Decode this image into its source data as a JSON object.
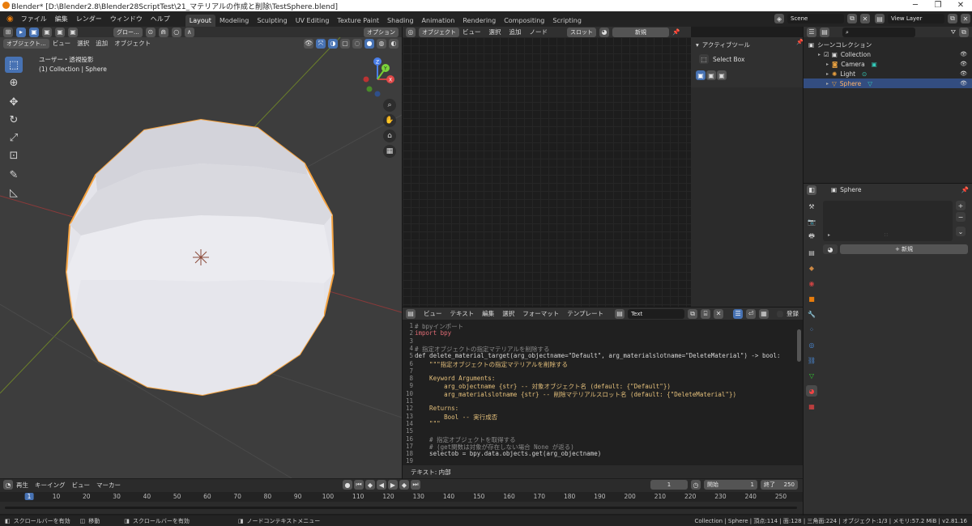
{
  "window": {
    "title": "Blender* [D:\\Blender2.8\\Blender28ScriptTest\\21_マテリアルの作成と削除\\TestSphere.blend]",
    "minimize": "─",
    "maximize": "❐",
    "close": "✕"
  },
  "topbar": {
    "menus": [
      "ファイル",
      "編集",
      "レンダー",
      "ウィンドウ",
      "ヘルプ"
    ],
    "workspaces": [
      "Layout",
      "Modeling",
      "Sculpting",
      "UV Editing",
      "Texture Paint",
      "Shading",
      "Animation",
      "Rendering",
      "Compositing",
      "Scripting"
    ],
    "active_workspace": "Layout",
    "scene": "Scene",
    "view_layer": "View Layer"
  },
  "viewport": {
    "mode": "オブジェクト...",
    "menus": [
      "ビュー",
      "選択",
      "追加",
      "オブジェクト"
    ],
    "transform": "グロー...",
    "options": "オプション",
    "overlay_title": "ユーザー・透視投影",
    "overlay_sub": "(1) Collection | Sphere",
    "gizmo": {
      "x": "X",
      "y": "Y",
      "z": "Z"
    }
  },
  "node_editor": {
    "mode": "オブジェクト",
    "menus": [
      "ビュー",
      "選択",
      "追加",
      "ノード"
    ],
    "slot": "スロット",
    "new": "新規",
    "active_tool": "アクティブツール",
    "select_box": "Select Box"
  },
  "text_editor": {
    "menus": [
      "ビュー",
      "テキスト",
      "編集",
      "選択",
      "フォーマット",
      "テンプレート"
    ],
    "filename": "Text",
    "register": "登録",
    "footer": "テキスト: 内部",
    "lines": [
      {
        "n": "1",
        "t": "# bpyインポート",
        "c": "cm"
      },
      {
        "n": "2",
        "t": "import bpy",
        "c": "kw"
      },
      {
        "n": "3",
        "t": "",
        "c": "fn"
      },
      {
        "n": "4",
        "t": "# 指定オブジェクトの指定マテリアルを削除する",
        "c": "cm"
      },
      {
        "n": "5",
        "t": "def delete_material_target(arg_objectname=\"Default\", arg_materialslotname=\"DeleteMaterial\") -> bool:",
        "c": "fn"
      },
      {
        "n": "6",
        "t": "    \"\"\"指定オブジェクトの指定マテリアルを削除する",
        "c": "st"
      },
      {
        "n": "7",
        "t": "",
        "c": "fn"
      },
      {
        "n": "8",
        "t": "    Keyword Arguments:",
        "c": "st"
      },
      {
        "n": "9",
        "t": "        arg_objectname {str} -- 対象オブジェクト名 (default: {\"Default\"})",
        "c": "st"
      },
      {
        "n": "10",
        "t": "        arg_materialslotname {str} -- 削除マテリアルスロット名 (default: {\"DeleteMaterial\"})",
        "c": "st"
      },
      {
        "n": "11",
        "t": "",
        "c": "fn"
      },
      {
        "n": "12",
        "t": "    Returns:",
        "c": "st"
      },
      {
        "n": "13",
        "t": "        Bool -- 実行成否",
        "c": "st"
      },
      {
        "n": "14",
        "t": "    \"\"\"",
        "c": "st"
      },
      {
        "n": "15",
        "t": "",
        "c": "fn"
      },
      {
        "n": "16",
        "t": "    # 指定オブジェクトを取得する",
        "c": "cm"
      },
      {
        "n": "17",
        "t": "    # (get関数は対象が存在しない場合 None が返る)",
        "c": "cm"
      },
      {
        "n": "18",
        "t": "    selectob = bpy.data.objects.get(arg_objectname)",
        "c": "fn"
      },
      {
        "n": "19",
        "t": "",
        "c": "fn"
      }
    ]
  },
  "outliner": {
    "root": "シーンコレクション",
    "items": [
      {
        "name": "Collection",
        "level": 1,
        "selected": false,
        "icon": "collection-icon"
      },
      {
        "name": "Camera",
        "level": 2,
        "selected": false,
        "icon": "camera-icon"
      },
      {
        "name": "Light",
        "level": 2,
        "selected": false,
        "icon": "light-icon"
      },
      {
        "name": "Sphere",
        "level": 2,
        "selected": true,
        "icon": "mesh-icon"
      }
    ]
  },
  "properties": {
    "object": "Sphere",
    "new": "新規"
  },
  "timeline": {
    "menus": [
      "再生",
      "キーイング",
      "ビュー",
      "マーカー"
    ],
    "current_frame": "1",
    "start_label": "開始",
    "start": "1",
    "end_label": "終了",
    "end": "250",
    "ticks": [
      "1",
      "10",
      "20",
      "30",
      "40",
      "50",
      "60",
      "70",
      "80",
      "90",
      "100",
      "110",
      "120",
      "130",
      "140",
      "150",
      "160",
      "170",
      "180",
      "190",
      "200",
      "210",
      "220",
      "230",
      "240",
      "250"
    ]
  },
  "statusbar": {
    "left": [
      "スクロールバーを有効",
      "移動",
      "スクロールバーを有効",
      "ノードコンテキストメニュー"
    ],
    "right": "Collection | Sphere | 頂点:114 | 面:128 | 三角面:224 | オブジェクト:1/3 | メモリ:57.2 MiB | v2.81.16"
  },
  "colors": {
    "accent": "#4772b3",
    "select_outline": "#f5a340",
    "bg": "#1d1d1d"
  }
}
